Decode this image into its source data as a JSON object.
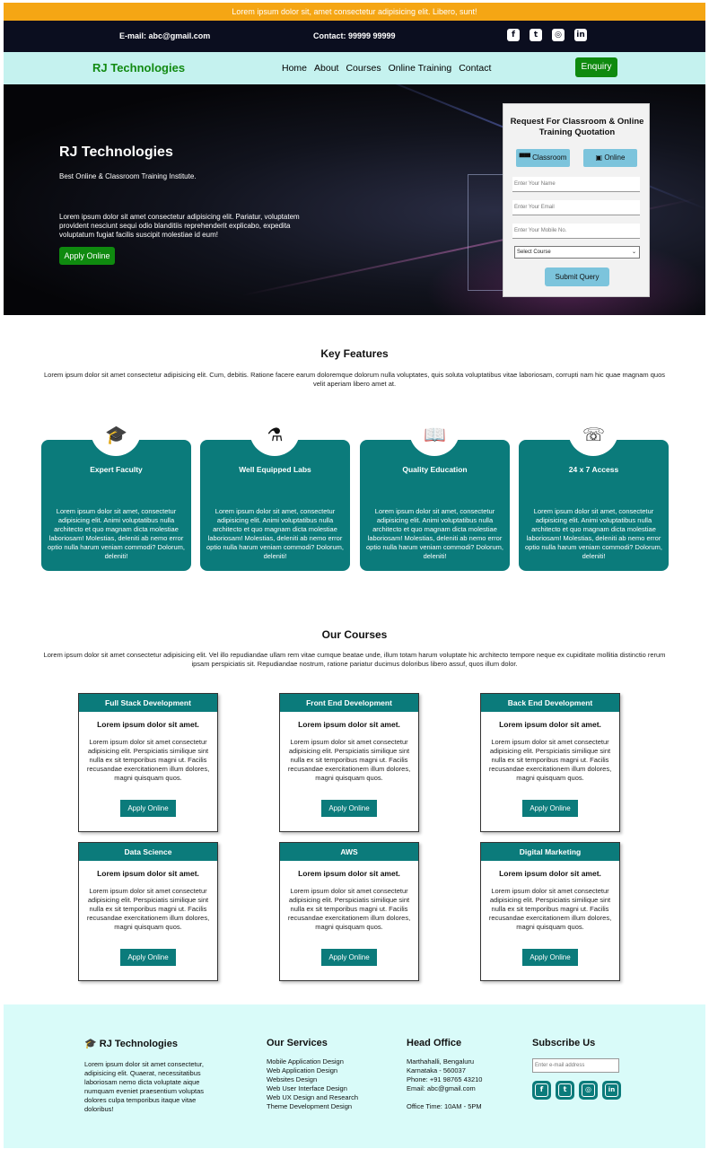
{
  "announcement": "Lorem ipsum dolor sit, amet consectetur adipisicing elit. Libero, sunt!",
  "topbar": {
    "email": "E-mail: abc@gmail.com",
    "phone": "Contact: 99999 99999",
    "socials": [
      {
        "icon": "facebook-icon",
        "glyph": "f"
      },
      {
        "icon": "twitter-icon",
        "glyph": "t"
      },
      {
        "icon": "instagram-icon",
        "glyph": "◎"
      },
      {
        "icon": "linkedin-icon",
        "glyph": "in"
      }
    ]
  },
  "navbar": {
    "brand": "RJ Technologies",
    "links": [
      "Home",
      "About",
      "Courses",
      "Online Training",
      "Contact"
    ],
    "enquiry": "Enquiry"
  },
  "hero": {
    "title": "RJ Technologies",
    "subtitle": "Best Online & Classroom Training Institute.",
    "body": "Lorem ipsum dolor sit amet consectetur adipisicing elit. Pariatur, voluptatem provident nesciunt sequi odio blanditiis reprehenderit explicabo, expedita voluptatum fugiat facilis suscipit molestiae id eum!",
    "apply": "Apply Online"
  },
  "quote_form": {
    "title": "Request For Classroom & Online Training Quotation",
    "classroom": "Classroom",
    "online": "Online",
    "name_placeholder": "Enter Your Name",
    "email_placeholder": "Enter Your Email",
    "mobile_placeholder": "Enter Your Mobile No.",
    "select": "Select Course",
    "submit": "Submit Query"
  },
  "key_features": {
    "title": "Key Features",
    "text": "Lorem ipsum dolor sit amet consectetur adipisicing elit. Cum, debitis. Ratione facere earum doloremque dolorum nulla voluptates, quis soluta voluptatibus vitae laboriosam, corrupti nam hic quae magnam quos velit aperiam libero amet at.",
    "items": [
      {
        "name": "Expert Faculty",
        "icon": "graduation-cap-icon",
        "desc": "Lorem ipsum dolor sit amet, consectetur adipisicing elit. Animi voluptatibus nulla architecto et quo magnam dicta molestiae laboriosam! Molestias, deleniti ab nemo error optio nulla harum veniam commodi? Dolorum, deleniti!"
      },
      {
        "name": "Well Equipped Labs",
        "icon": "flask-icon",
        "desc": "Lorem ipsum dolor sit amet, consectetur adipisicing elit. Animi voluptatibus nulla architecto et quo magnam dicta molestiae laboriosam! Molestias, deleniti ab nemo error optio nulla harum veniam commodi? Dolorum, deleniti!"
      },
      {
        "name": "Quality Education",
        "icon": "book-icon",
        "desc": "Lorem ipsum dolor sit amet, consectetur adipisicing elit. Animi voluptatibus nulla architecto et quo magnam dicta molestiae laboriosam! Molestias, deleniti ab nemo error optio nulla harum veniam commodi? Dolorum, deleniti!"
      },
      {
        "name": "24 x 7 Access",
        "icon": "phone-24-icon",
        "desc": "Lorem ipsum dolor sit amet, consectetur adipisicing elit. Animi voluptatibus nulla architecto et quo magnam dicta molestiae laboriosam! Molestias, deleniti ab nemo error optio nulla harum veniam commodi? Dolorum, deleniti!"
      }
    ]
  },
  "courses": {
    "title": "Our Courses",
    "text": "Lorem ipsum dolor sit amet consectetur adipisicing elit. Vel illo repudiandae ullam rem vitae cumque beatae unde, illum totam harum voluptate hic architecto tempore neque ex cupiditate mollitia distinctio rerum ipsam perspiciatis sit. Repudiandae nostrum, ratione pariatur ducimus doloribus libero assuf, quos illum dolor.",
    "items": [
      {
        "name": "Full Stack Development",
        "subtitle": "Lorem ipsum dolor sit amet.",
        "desc": "Lorem ipsum dolor sit amet consectetur adipisicing elit. Perspiciatis similique sint nulla ex sit temporibus magni ut. Facilis recusandae exercitationem illum dolores, magni quisquam quos.",
        "apply": "Apply Online"
      },
      {
        "name": "Front End Development",
        "subtitle": "Lorem ipsum dolor sit amet.",
        "desc": "Lorem ipsum dolor sit amet consectetur adipisicing elit. Perspiciatis similique sint nulla ex sit temporibus magni ut. Facilis recusandae exercitationem illum dolores, magni quisquam quos.",
        "apply": "Apply Online"
      },
      {
        "name": "Back End Development",
        "subtitle": "Lorem ipsum dolor sit amet.",
        "desc": "Lorem ipsum dolor sit amet consectetur adipisicing elit. Perspiciatis similique sint nulla ex sit temporibus magni ut. Facilis recusandae exercitationem illum dolores, magni quisquam quos.",
        "apply": "Apply Online"
      },
      {
        "name": "Data Science",
        "subtitle": "Lorem ipsum dolor sit amet.",
        "desc": "Lorem ipsum dolor sit amet consectetur adipisicing elit. Perspiciatis similique sint nulla ex sit temporibus magni ut. Facilis recusandae exercitationem illum dolores, magni quisquam quos.",
        "apply": "Apply Online"
      },
      {
        "name": "AWS",
        "subtitle": "Lorem ipsum dolor sit amet.",
        "desc": "Lorem ipsum dolor sit amet consectetur adipisicing elit. Perspiciatis similique sint nulla ex sit temporibus magni ut. Facilis recusandae exercitationem illum dolores, magni quisquam quos.",
        "apply": "Apply Online"
      },
      {
        "name": "Digital Marketing",
        "subtitle": "Lorem ipsum dolor sit amet.",
        "desc": "Lorem ipsum dolor sit amet consectetur adipisicing elit. Perspiciatis similique sint nulla ex sit temporibus magni ut. Facilis recusandae exercitationem illum dolores, magni quisquam quos.",
        "apply": "Apply Online"
      }
    ]
  },
  "footer": {
    "brand": "RJ Technologies",
    "about": "Lorem ipsum dolor sit amet consectetur, adipisicing elit. Quaerat, necessitatibus laboriosam nemo dicta voluptate aique numquam eveniet praesentium voluptas dolores culpa temporibus itaque vitae doloribus!",
    "services_title": "Our Services",
    "services": [
      "Mobile Application Design",
      "Web Application Design",
      "Websites Design",
      "Web User Interface Design",
      "Web UX Design and Research",
      "Theme Development Design"
    ],
    "office_title": "Head Office",
    "office": [
      "Marthahalli, Bengaluru",
      "Karnataka - 560037",
      "Phone: +91 98765 43210",
      "Email: abc@gmail.com",
      "",
      "Office Time: 10AM - 5PM"
    ],
    "subscribe_title": "Subscribe Us",
    "subscribe_placeholder": "Enter e-mail address"
  }
}
